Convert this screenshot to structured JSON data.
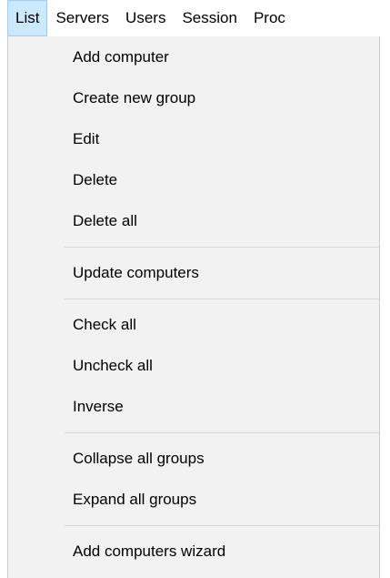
{
  "menubar": {
    "items": [
      {
        "label": "List",
        "active": true
      },
      {
        "label": "Servers"
      },
      {
        "label": "Users"
      },
      {
        "label": "Session"
      },
      {
        "label": "Proc"
      }
    ]
  },
  "dropdown": {
    "groups": [
      [
        "Add computer",
        "Create new group",
        "Edit",
        "Delete",
        "Delete all"
      ],
      [
        "Update computers"
      ],
      [
        "Check all",
        "Uncheck all",
        "Inverse"
      ],
      [
        "Collapse all groups",
        "Expand all groups"
      ],
      [
        "Add computers wizard"
      ]
    ]
  },
  "colors": {
    "active_menu_bg": "#cce8ff",
    "active_menu_border": "#99d1ff",
    "dropdown_bg": "#f2f2f2",
    "separator": "#d7d7d7"
  }
}
